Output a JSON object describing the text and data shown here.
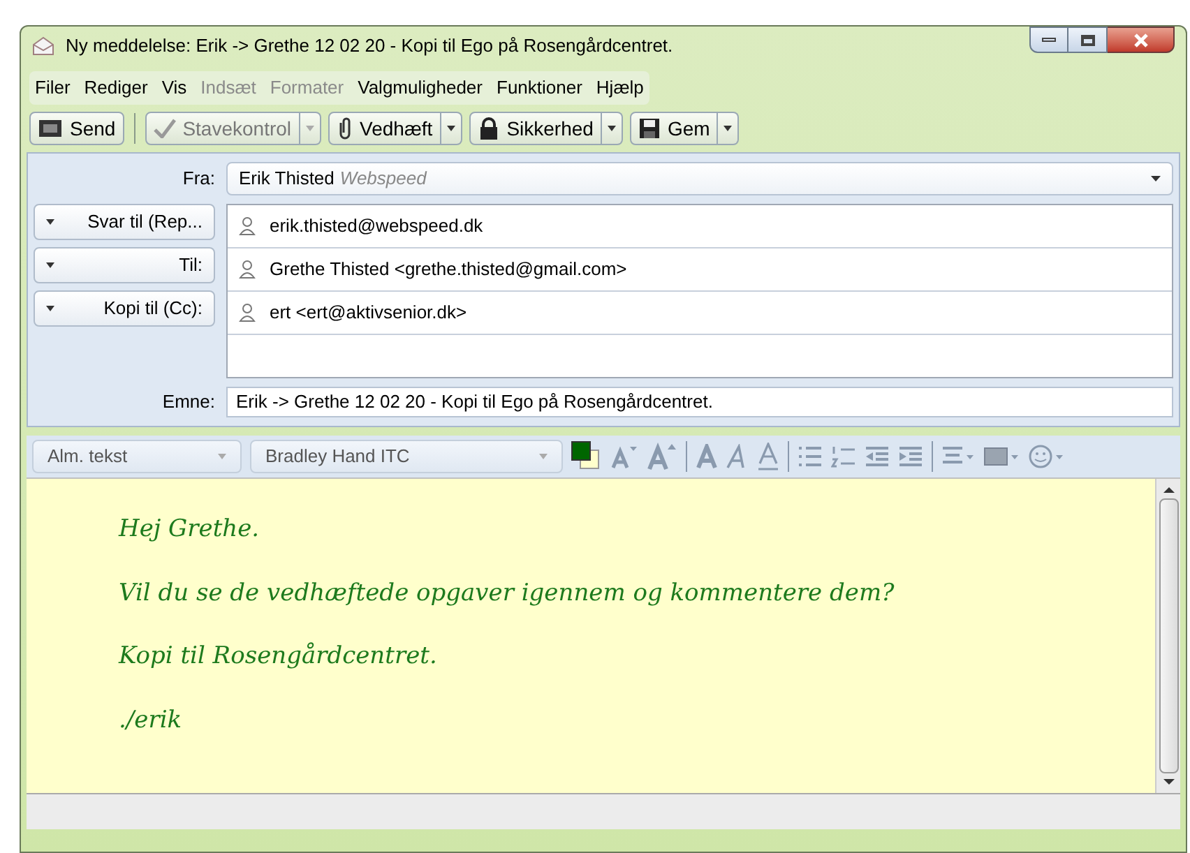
{
  "window": {
    "title": "Ny meddelelse: Erik -> Grethe 12 02 20 - Kopi til Ego på Rosengårdcentret."
  },
  "menu": [
    {
      "label": "Filer",
      "disabled": false
    },
    {
      "label": "Rediger",
      "disabled": false
    },
    {
      "label": "Vis",
      "disabled": false
    },
    {
      "label": "Indsæt",
      "disabled": true
    },
    {
      "label": "Formater",
      "disabled": true
    },
    {
      "label": "Valgmuligheder",
      "disabled": false
    },
    {
      "label": "Funktioner",
      "disabled": false
    },
    {
      "label": "Hjælp",
      "disabled": false
    }
  ],
  "toolbar": [
    {
      "label": "Send",
      "kind": "send",
      "disabled": false,
      "dropdown": false
    },
    {
      "label": "Stavekontrol",
      "kind": "spell",
      "disabled": true,
      "dropdown": true
    },
    {
      "label": "Vedhæft",
      "kind": "attach",
      "disabled": false,
      "dropdown": true
    },
    {
      "label": "Sikkerhed",
      "kind": "lock",
      "disabled": false,
      "dropdown": true
    },
    {
      "label": "Gem",
      "kind": "save",
      "disabled": false,
      "dropdown": true
    }
  ],
  "from": {
    "label": "Fra:",
    "name": "Erik Thisted",
    "account": "Webspeed"
  },
  "recipients": [
    {
      "type_label": "Svar til (Rep...",
      "address": "erik.thisted@webspeed.dk"
    },
    {
      "type_label": "Til:",
      "address": "Grethe Thisted <grethe.thisted@gmail.com>"
    },
    {
      "type_label": "Kopi til (Cc):",
      "address": "ert <ert@aktivsenior.dk>"
    }
  ],
  "subject": {
    "label": "Emne:",
    "value": "Erik -> Grethe 12 02 20 - Kopi til Ego på Rosengårdcentret."
  },
  "format_bar": {
    "paragraph_style": "Alm. tekst",
    "font": "Bradley Hand ITC"
  },
  "body": [
    "Hej Grethe.",
    "Vil du se de vedhæftede opgaver igennem og kommentere dem?",
    "Kopi til Rosengårdcentret.",
    "./erik"
  ]
}
